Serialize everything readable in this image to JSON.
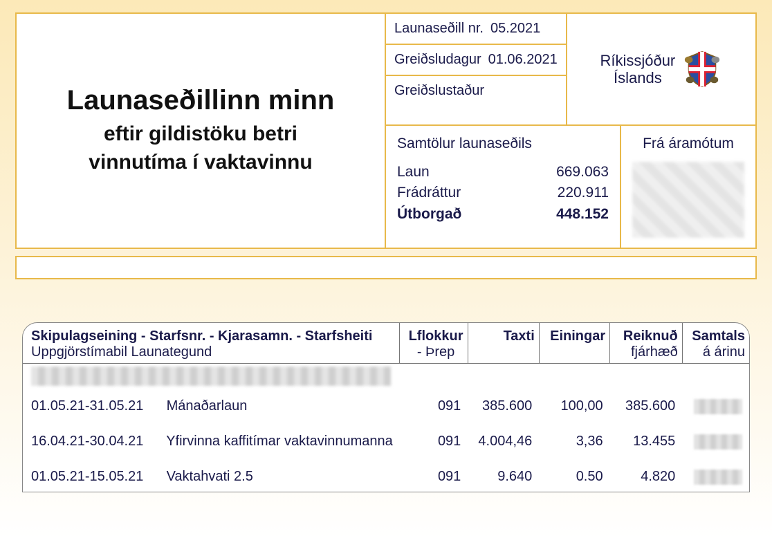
{
  "title": {
    "main": "Launaseðillinn minn",
    "sub1": "eftir gildistöku betri",
    "sub2": "vinnutíma í vaktavinnu"
  },
  "header": {
    "slip_no_label": "Launaseðill nr.",
    "slip_no_value": "05.2021",
    "paydate_label": "Greiðsludagur",
    "paydate_value": "01.06.2021",
    "paypoint_label": "Greiðslustaður",
    "issuer_line1": "Ríkissjóður",
    "issuer_line2": "Íslands"
  },
  "summary": {
    "heading": "Samtölur launaseðils",
    "rows": [
      {
        "label": "Laun",
        "value": "669.063"
      },
      {
        "label": "Frádráttur",
        "value": "220.911"
      }
    ],
    "total_label": "Útborgað",
    "total_value": "448.152"
  },
  "ytd": {
    "heading": "Frá áramótum"
  },
  "table": {
    "head": {
      "col1_line1": "Skipulagseining - Starfsnr. - Kjarasamn. - Starfsheiti",
      "col1_line2": "Uppgjörstímabil    Launategund",
      "col2_line1": "Lflokkur",
      "col2_line2": "- Þrep",
      "col3": "Taxti",
      "col4": "Einingar",
      "col5_line1": "Reiknuð",
      "col5_line2": "fjárhæð",
      "col6_line1": "Samtals",
      "col6_line2": "á árinu"
    },
    "rows": [
      {
        "period": "01.05.21-31.05.21",
        "type": "Mánaðarlaun",
        "lflokkur": "091",
        "taxti": "385.600",
        "einingar": "100,00",
        "fjarhaed": "385.600"
      },
      {
        "period": "16.04.21-30.04.21",
        "type": "Yfirvinna kaffitímar vaktavinnumanna",
        "lflokkur": "091",
        "taxti": "4.004,46",
        "einingar": "3,36",
        "fjarhaed": "13.455"
      },
      {
        "period": "01.05.21-15.05.21",
        "type": "Vaktahvati 2.5",
        "lflokkur": "091",
        "taxti": "9.640",
        "einingar": "0.50",
        "fjarhaed": "4.820"
      }
    ]
  }
}
